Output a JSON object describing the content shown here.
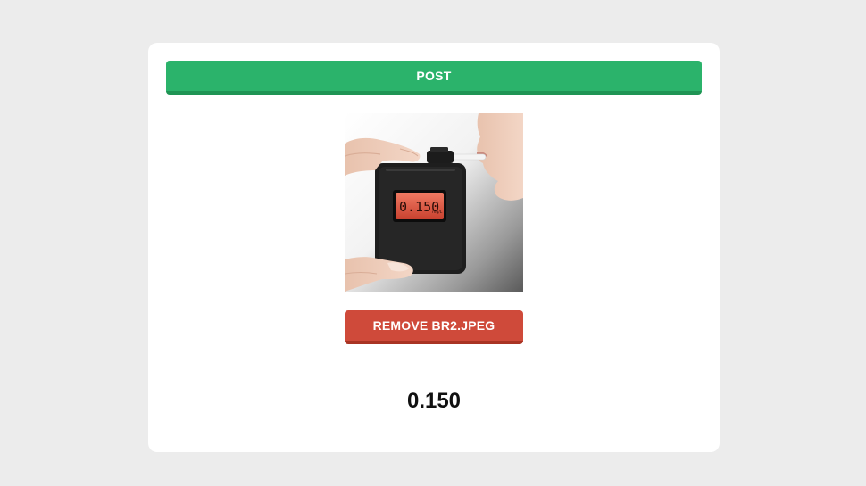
{
  "post_button": {
    "label": "POST"
  },
  "upload": {
    "image_alt": "breathalyzer photo",
    "screen_reading": "0.150",
    "screen_unit": "mg/L",
    "remove_label": "REMOVE BR2.JPEG"
  },
  "result": {
    "value": "0.150"
  },
  "colors": {
    "post": "#2bb36b",
    "remove": "#cf4a3a",
    "lcd": "#e0553f"
  }
}
